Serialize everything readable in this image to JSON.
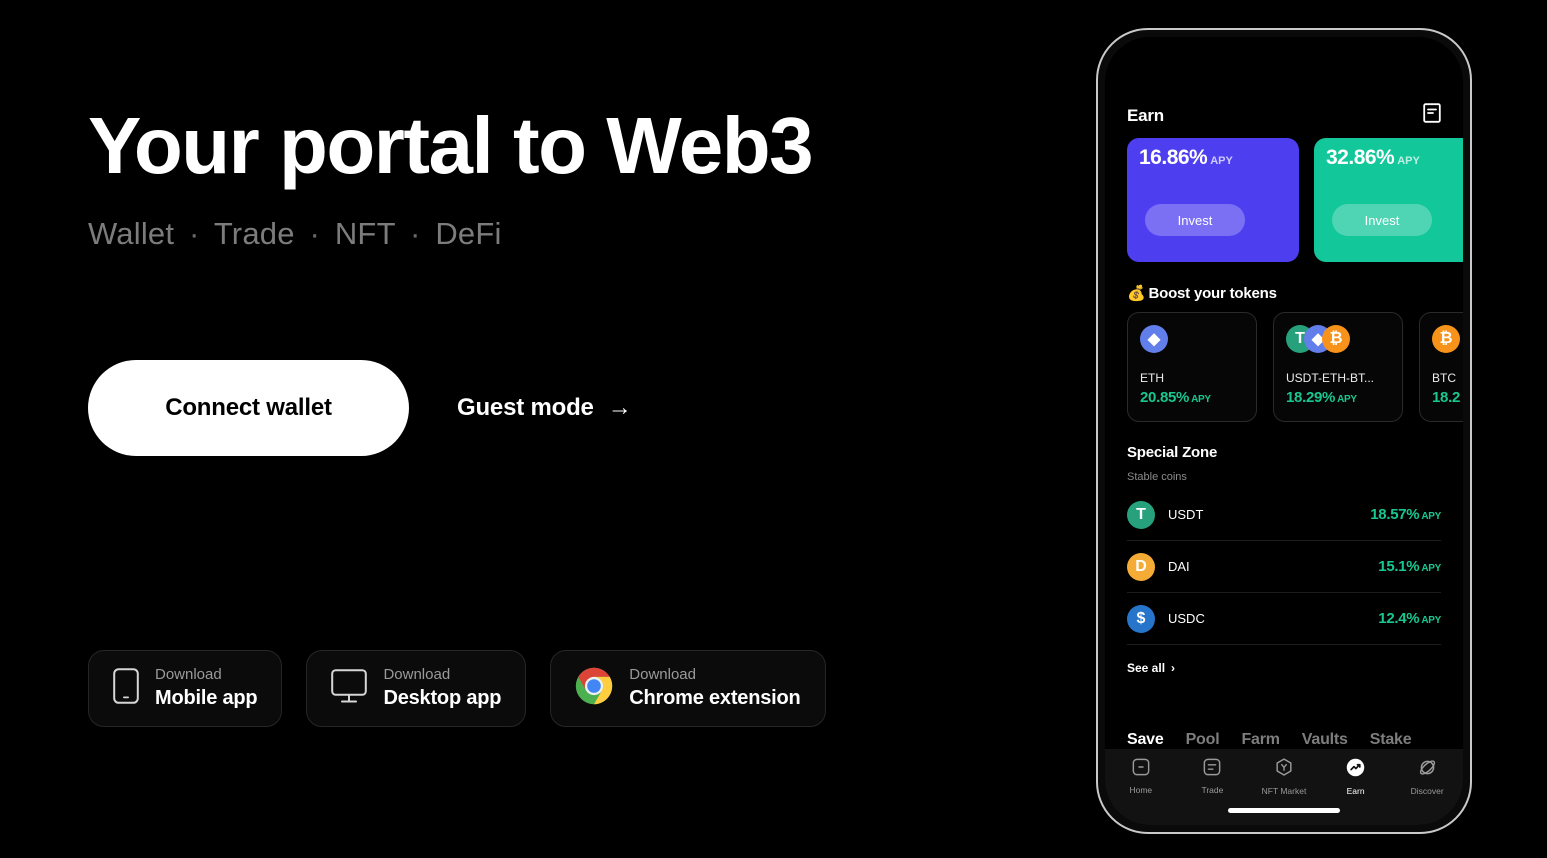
{
  "hero": {
    "title": "Your portal to Web3",
    "subtitle_items": [
      "Wallet",
      "Trade",
      "NFT",
      "DeFi"
    ],
    "separator": "·"
  },
  "cta": {
    "connect_label": "Connect wallet",
    "guest_label": "Guest mode",
    "guest_arrow": "→"
  },
  "downloads": [
    {
      "icon": "mobile-phone-icon",
      "top": "Download",
      "bottom": "Mobile app"
    },
    {
      "icon": "desktop-monitor-icon",
      "top": "Download",
      "bottom": "Desktop app"
    },
    {
      "icon": "chrome-logo-icon",
      "top": "Download",
      "bottom": "Chrome extension"
    }
  ],
  "phone": {
    "header": {
      "title": "Earn",
      "action_icon": "order-list-icon"
    },
    "apy_cards": [
      {
        "value": "16.86%",
        "unit": "APY",
        "button": "Invest",
        "color": "#4d3ff0"
      },
      {
        "value": "32.86%",
        "unit": "APY",
        "button": "Invest",
        "color": "#12c79a"
      }
    ],
    "boost": {
      "emoji": "💰",
      "title": "Boost your tokens",
      "cards": [
        {
          "coins": [
            "eth"
          ],
          "name": "ETH",
          "apy": "20.85%",
          "unit": "APY"
        },
        {
          "coins": [
            "usdt",
            "eth",
            "btc"
          ],
          "name": "USDT-ETH-BT...",
          "apy": "18.29%",
          "unit": "APY"
        },
        {
          "coins": [
            "btc"
          ],
          "name": "BTC",
          "apy": "18.2",
          "unit": ""
        }
      ]
    },
    "special": {
      "title": "Special Zone",
      "subtitle": "Stable coins",
      "rows": [
        {
          "coin": "usdt",
          "symbol": "T",
          "name": "USDT",
          "apy": "18.57%",
          "unit": "APY"
        },
        {
          "coin": "dai",
          "symbol": "D",
          "name": "DAI",
          "apy": "15.1%",
          "unit": "APY"
        },
        {
          "coin": "usdc",
          "symbol": "$",
          "name": "USDC",
          "apy": "12.4%",
          "unit": "APY"
        }
      ],
      "see_all": "See all",
      "see_all_chevron": "›"
    },
    "subtabs": [
      {
        "label": "Save",
        "active": true
      },
      {
        "label": "Pool",
        "active": false
      },
      {
        "label": "Farm",
        "active": false
      },
      {
        "label": "Vaults",
        "active": false
      },
      {
        "label": "Stake",
        "active": false
      }
    ],
    "tabbar": [
      {
        "label": "Home",
        "icon": "home-icon",
        "active": false
      },
      {
        "label": "Trade",
        "icon": "trade-icon",
        "active": false
      },
      {
        "label": "NFT Market",
        "icon": "nft-icon",
        "active": false
      },
      {
        "label": "Earn",
        "icon": "earn-icon",
        "active": true
      },
      {
        "label": "Discover",
        "icon": "discover-icon",
        "active": false
      }
    ]
  },
  "colors": {
    "background": "#000000",
    "accent_green": "#18c78f",
    "accent_purple": "#4d3ff0",
    "muted_text": "#7c7c7c"
  }
}
